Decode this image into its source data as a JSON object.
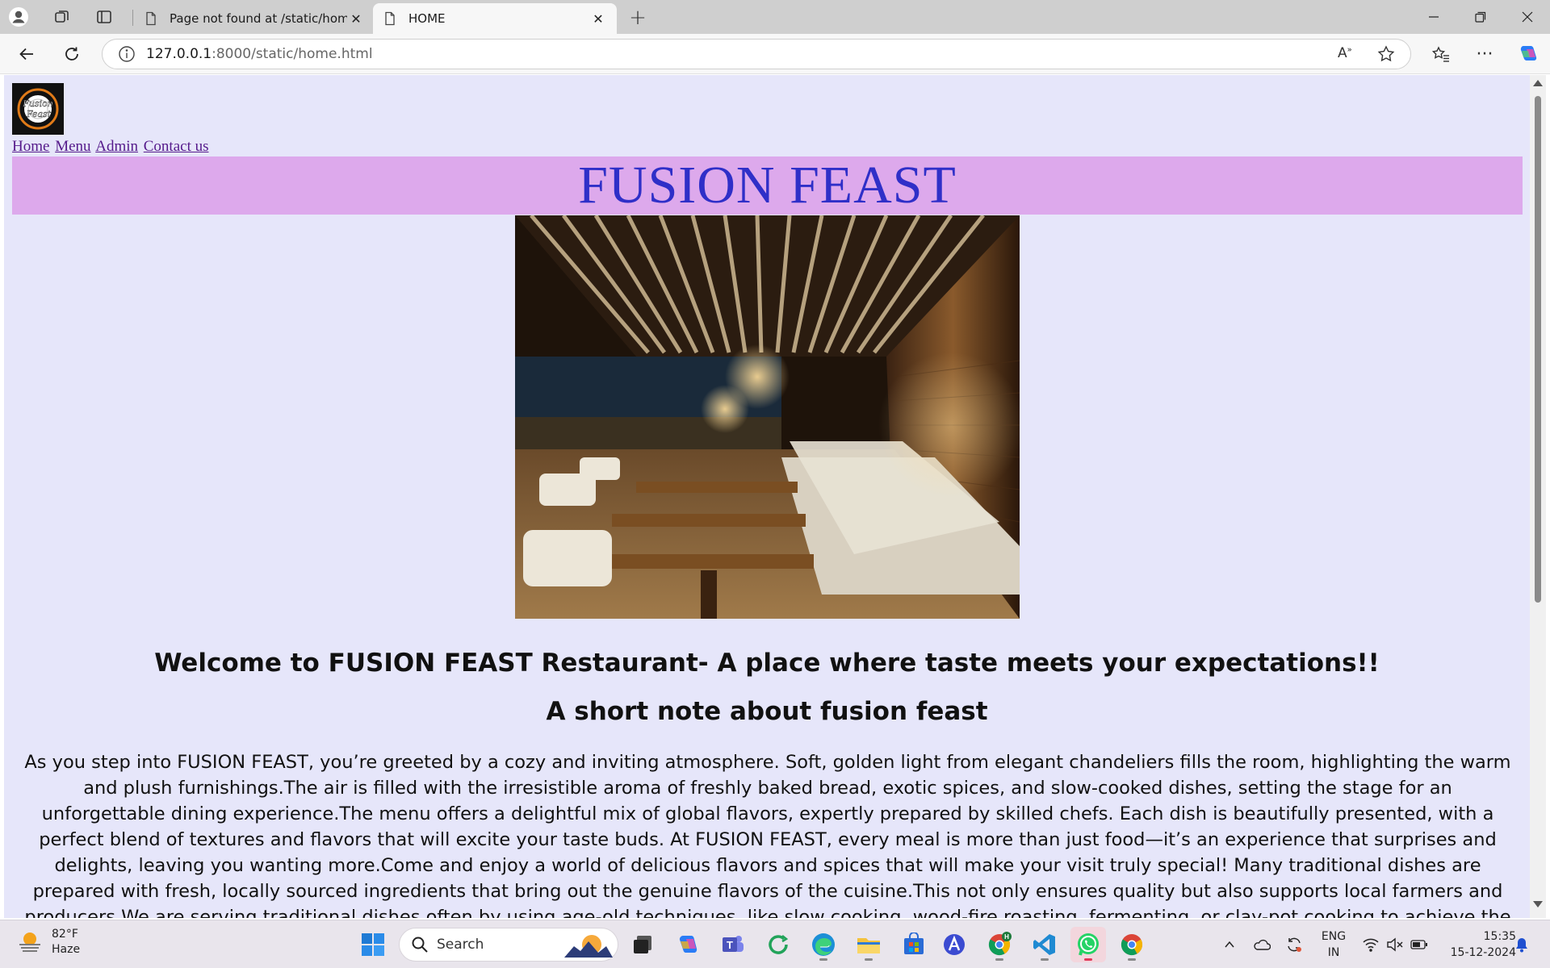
{
  "browser": {
    "tabs": [
      {
        "title": "Page not found at /static/home.h",
        "active": false
      },
      {
        "title": "HOME",
        "active": true
      }
    ],
    "url_host": "127.0.0.1",
    "url_rest": ":8000/static/home.html",
    "icons": [
      "profile-icon",
      "workspaces-icon",
      "tab-actions-icon",
      "page-icon",
      "close-icon",
      "new-tab-icon",
      "minimize-icon",
      "maximize-icon",
      "window-close-icon",
      "back-icon",
      "refresh-icon",
      "info-icon",
      "read-aloud-icon",
      "favorite-star-icon",
      "favorites-icon",
      "more-icon",
      "copilot-icon"
    ]
  },
  "page": {
    "logo_text": "Fusion Feast",
    "nav": [
      "Home",
      "Menu",
      "Admin",
      "Contact us"
    ],
    "banner_title": "FUSION FEAST",
    "welcome": "Welcome to FUSION FEAST Restaurant- A place where taste meets your expectations!!",
    "subheading": "A short note about fusion feast",
    "paragraph": "As you step into FUSION FEAST, you’re greeted by a cozy and inviting atmosphere. Soft, golden light from elegant chandeliers fills the room, highlighting the warm and plush furnishings.The air is filled with the irresistible aroma of freshly baked bread, exotic spices, and slow-cooked dishes, setting the stage for an unforgettable dining experience.The menu offers a delightful mix of global flavors, expertly prepared by skilled chefs. Each dish is beautifully presented, with a perfect blend of textures and flavors that will excite your taste buds. At FUSION FEAST, every meal is more than just food—it’s an experience that surprises and delights, leaving you wanting more.Come and enjoy a world of delicious flavors and spices that will make your visit truly special! Many traditional dishes are prepared with fresh, locally sourced ingredients that bring out the genuine flavors of the cuisine.This not only ensures quality but also supports local farmers and producers.We are serving traditional dishes often by using age-old techniques, like slow cooking, wood-fire roasting, fermenting, or clay-pot cooking to achieve the original taste and texture.The experience of traditional dining extends to the"
  },
  "taskbar": {
    "weather_temp": "82°F",
    "weather_desc": "Haze",
    "search_label": "Search",
    "lang_top": "ENG",
    "lang_bottom": "IN",
    "time": "15:35",
    "date": "15-12-2024"
  },
  "colors": {
    "page_bg": "#e6e6fa",
    "banner_bg": "#dda9ec",
    "banner_text": "#2f2fc8",
    "link": "#551a8b"
  }
}
